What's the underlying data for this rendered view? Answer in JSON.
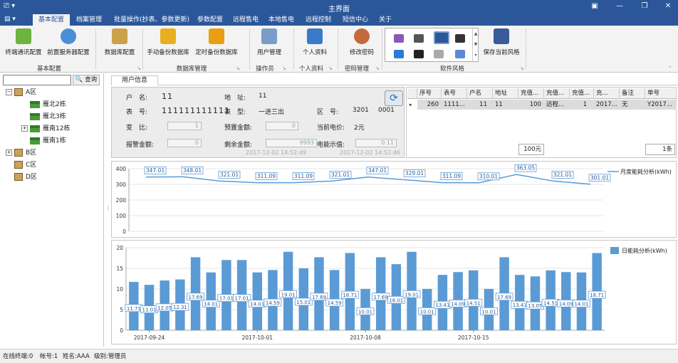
{
  "window": {
    "title": "主界面"
  },
  "ribbon_tabs": [
    "基本配置",
    "档案管理",
    "批量操作(抄表、参数更新)",
    "参数配置",
    "远程售电",
    "本地售电",
    "远程控制",
    "短信中心",
    "关于"
  ],
  "ribbon": {
    "buttons": [
      "终端通讯配置",
      "前置服务器配置",
      "数据库配置",
      "手动备份数据库",
      "定时备份数据库",
      "用户管理",
      "个人资料",
      "修改密码",
      "保存当前风格"
    ],
    "groups": [
      "基本配置",
      "数据库管理",
      "操作员",
      "个人资料",
      "密码管理",
      "软件风格"
    ]
  },
  "search": {
    "button": "查询"
  },
  "tree": {
    "areas": [
      "A区",
      "B区",
      "C区",
      "D区"
    ],
    "buildings": [
      "雁北2栋",
      "雁北3栋",
      "雁南12栋",
      "雁南1栋"
    ]
  },
  "content_tab": "用户信息",
  "info": {
    "labels": {
      "household": "户　名:",
      "address": "地　址:",
      "meter_no": "表　号:",
      "meter_type": "表　型:",
      "area_no": "区　号:",
      "ratio": "变　比:",
      "preset": "预置金额:",
      "price": "当前电价:",
      "alarm": "报警金额:",
      "remain": "剩余金额:",
      "reading": "电能示值:"
    },
    "values": {
      "household": "11",
      "address": "11",
      "meter_no": "111111111111",
      "meter_type": "一进三出",
      "area_no": "3201",
      "area_no2": "0001",
      "ratio": "1",
      "preset": "0",
      "price": "2元",
      "alarm": "0",
      "remain": "9993",
      "reading": "0.11"
    },
    "time1": "2017-12-02 14:52:49",
    "time2": "2017-12-02 14:52:46"
  },
  "grid": {
    "headers": [
      "序号",
      "表号",
      "户名",
      "地址",
      "充值...",
      "充值...",
      "充值...",
      "充...",
      "备注",
      "单号"
    ],
    "row": [
      "260",
      "1111...",
      "11",
      "11",
      "100",
      "远程...",
      "1",
      "2017...",
      "无",
      "Y2017..."
    ],
    "total_amount": "100元",
    "total_count": "1条"
  },
  "chart_data": [
    {
      "type": "line",
      "legend": "月度能耗分析(kWh)",
      "ylim": [
        0,
        400
      ],
      "yticks": [
        0,
        100,
        200,
        300,
        400
      ],
      "values": [
        347.01,
        348.01,
        321.01,
        311.09,
        311.09,
        321.01,
        347.01,
        329.01,
        311.09,
        310.01,
        363.05,
        321.01,
        301.01
      ],
      "color": "#5b9bd5"
    },
    {
      "type": "bar",
      "legend": "日能耗分析(kWh)",
      "ylim": [
        0,
        20
      ],
      "yticks": [
        0,
        5,
        10,
        15,
        20
      ],
      "xticks": [
        "2017-09-24",
        "2017-10-01",
        "2017-10-08",
        "2017-10-15"
      ],
      "values": [
        11.71,
        11.01,
        12.05,
        12.31,
        17.69,
        14.01,
        17.01,
        17.01,
        14.01,
        14.59,
        19.01,
        15.01,
        17.69,
        14.59,
        18.71,
        10.01,
        17.69,
        16.01,
        19.01,
        10.01,
        13.41,
        14.09,
        14.51,
        10.01,
        17.69,
        13.41,
        13.05,
        14.51,
        14.09,
        14.01,
        18.71
      ],
      "color": "#5b9bd5"
    }
  ],
  "status": {
    "online": "在线终端:0",
    "account": "帐号:1",
    "name": "姓名:AAA",
    "level": "级别:管理员"
  },
  "colors": {
    "accent": "#2b579a",
    "chart": "#5b9bd5"
  }
}
